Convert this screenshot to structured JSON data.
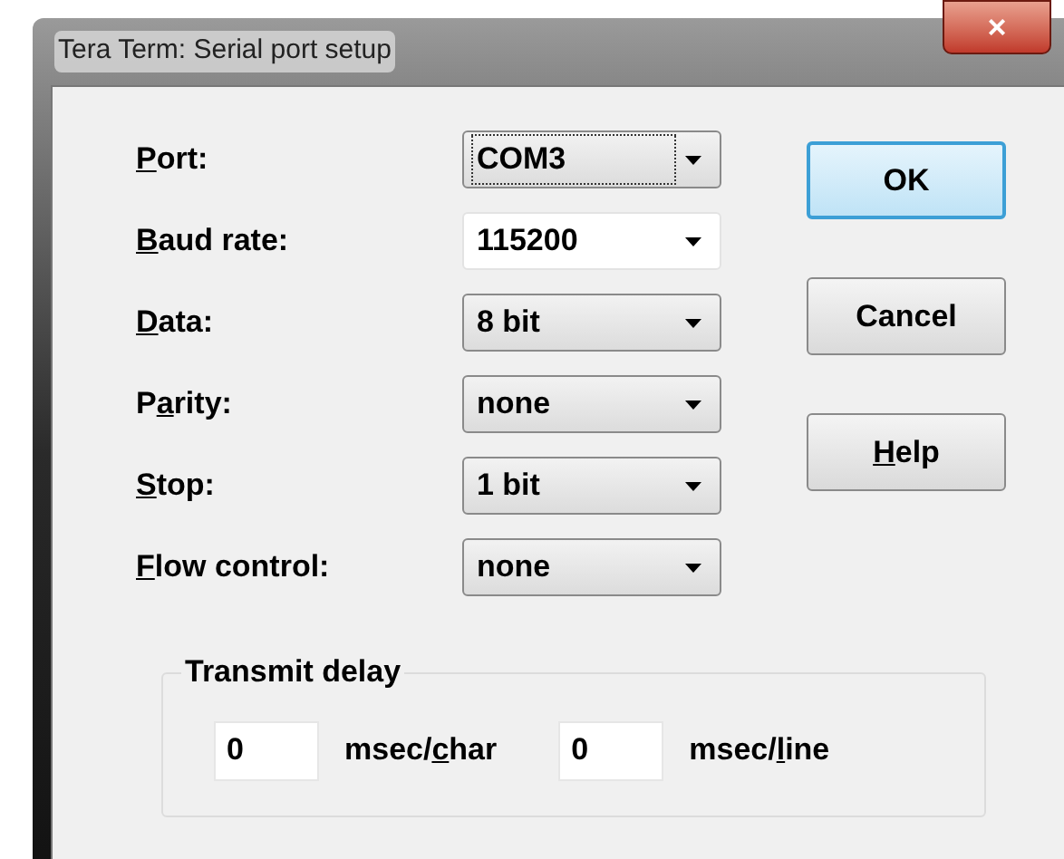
{
  "window": {
    "title": "Tera Term: Serial port setup",
    "close": "×"
  },
  "fields": [
    {
      "label": {
        "key": "P",
        "after": "ort:"
      },
      "value": "COM3",
      "kind": "dropdown",
      "focused": true
    },
    {
      "label": {
        "key": "B",
        "after": "aud rate:"
      },
      "value": "115200",
      "kind": "editable",
      "focused": false
    },
    {
      "label": {
        "key": "D",
        "after": "ata:"
      },
      "value": "8 bit",
      "kind": "dropdown",
      "focused": false
    },
    {
      "label": {
        "before": "P",
        "key": "a",
        "after": "rity:"
      },
      "value": "none",
      "kind": "dropdown",
      "focused": false
    },
    {
      "label": {
        "key": "S",
        "after": "top:"
      },
      "value": "1 bit",
      "kind": "dropdown",
      "focused": false
    },
    {
      "label": {
        "key": "F",
        "after": "low control:"
      },
      "value": "none",
      "kind": "dropdown",
      "focused": false
    }
  ],
  "buttons": [
    {
      "label": {
        "before": "OK"
      },
      "default": true
    },
    {
      "label": {
        "before": "Cancel"
      },
      "default": false
    },
    {
      "label": {
        "key": "H",
        "after": "elp"
      },
      "default": false
    }
  ],
  "transmit_delay": {
    "title": "Transmit delay",
    "inputs": [
      {
        "value": "0",
        "unit": {
          "before": "msec/",
          "key": "c",
          "after": "har"
        }
      },
      {
        "value": "0",
        "unit": {
          "before": "msec/",
          "key": "l",
          "after": "ine"
        }
      }
    ]
  }
}
